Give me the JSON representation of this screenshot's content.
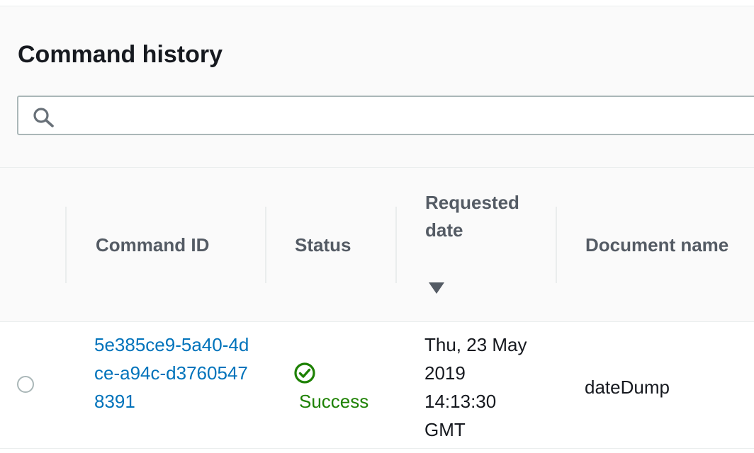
{
  "page": {
    "title": "Command history"
  },
  "search": {
    "value": "",
    "placeholder": ""
  },
  "table": {
    "columns": {
      "command_id": "Command ID",
      "status": "Status",
      "requested_date": "Requested date",
      "document_name": "Document name"
    },
    "sort": {
      "column": "requested_date",
      "direction": "descending"
    },
    "rows": [
      {
        "selected": false,
        "command_id": "5e385ce9-5a40-4dce-a94c-d37605478391",
        "status": "Success",
        "requested_date": "Thu, 23 May 2019 14:13:30 GMT",
        "document_name": "dateDump"
      }
    ]
  },
  "colors": {
    "link": "#0073bb",
    "success": "#1d8102",
    "header_text": "#545b64",
    "body_text": "#16191f",
    "border": "#eaeded"
  },
  "icons": {
    "search": "search-icon",
    "sort": "caret-down-icon",
    "status": "check-circle-icon"
  }
}
